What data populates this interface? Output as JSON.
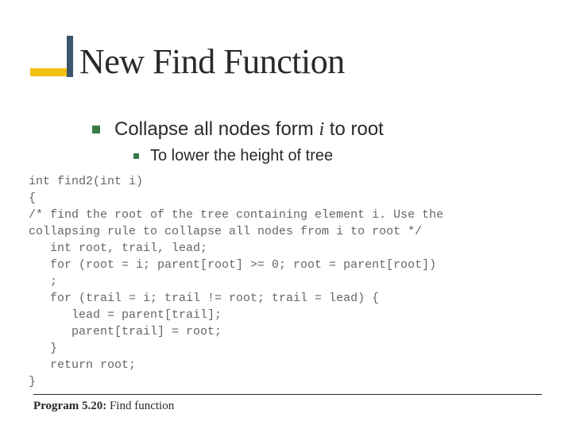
{
  "title": "New Find Function",
  "bullets": {
    "b1_prefix": "Collapse all nodes form ",
    "b1_italic": "i",
    "b1_suffix": " to root",
    "b2": "To lower the height of tree"
  },
  "code": {
    "lines": [
      "int find2(int i)",
      "{",
      "/* find the root of the tree containing element i. Use the",
      "collapsing rule to collapse all nodes from i to root */",
      "   int root, trail, lead;",
      "   for (root = i; parent[root] >= 0; root = parent[root])",
      "   ;",
      "   for (trail = i; trail != root; trail = lead) {",
      "      lead = parent[trail];",
      "      parent[trail] = root;",
      "   }",
      "   return root;",
      "}"
    ]
  },
  "caption": {
    "label": "Program 5.20:",
    "text": " Find function"
  }
}
